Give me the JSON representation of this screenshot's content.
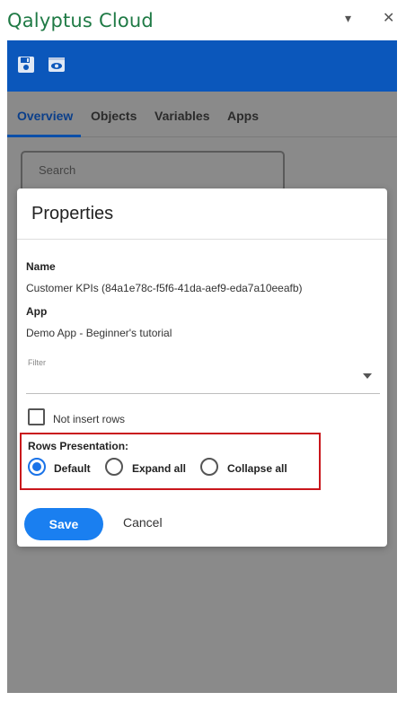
{
  "pane": {
    "title": "Qalyptus Cloud",
    "dropdown_glyph": "▾",
    "close_glyph": "✕"
  },
  "toolbar": {
    "icons": [
      "save-icon",
      "preview-icon"
    ]
  },
  "tabs": [
    {
      "label": "Overview",
      "active": true
    },
    {
      "label": "Objects",
      "active": false
    },
    {
      "label": "Variables",
      "active": false
    },
    {
      "label": "Apps",
      "active": false
    }
  ],
  "search": {
    "placeholder": "Search",
    "value": ""
  },
  "dialog": {
    "title": "Properties",
    "name_label": "Name",
    "name_value": "Customer KPIs (84a1e78c-f5f6-41da-aef9-eda7a10eeafb)",
    "app_label": "App",
    "app_value": "Demo App - Beginner's tutorial",
    "filter_label": "Filter",
    "filter_value": "",
    "not_insert_rows_label": "Not insert rows",
    "not_insert_rows_checked": false,
    "rows_presentation_label": "Rows Presentation:",
    "rows_options": [
      {
        "label": "Default",
        "checked": true
      },
      {
        "label": "Expand all",
        "checked": false
      },
      {
        "label": "Collapse all",
        "checked": false
      }
    ],
    "save_label": "Save",
    "cancel_label": "Cancel"
  },
  "colors": {
    "brand_green": "#1f7a45",
    "toolbar_blue": "#0b57bb",
    "primary_button": "#1a7ff0",
    "highlight_red": "#c9161c"
  }
}
